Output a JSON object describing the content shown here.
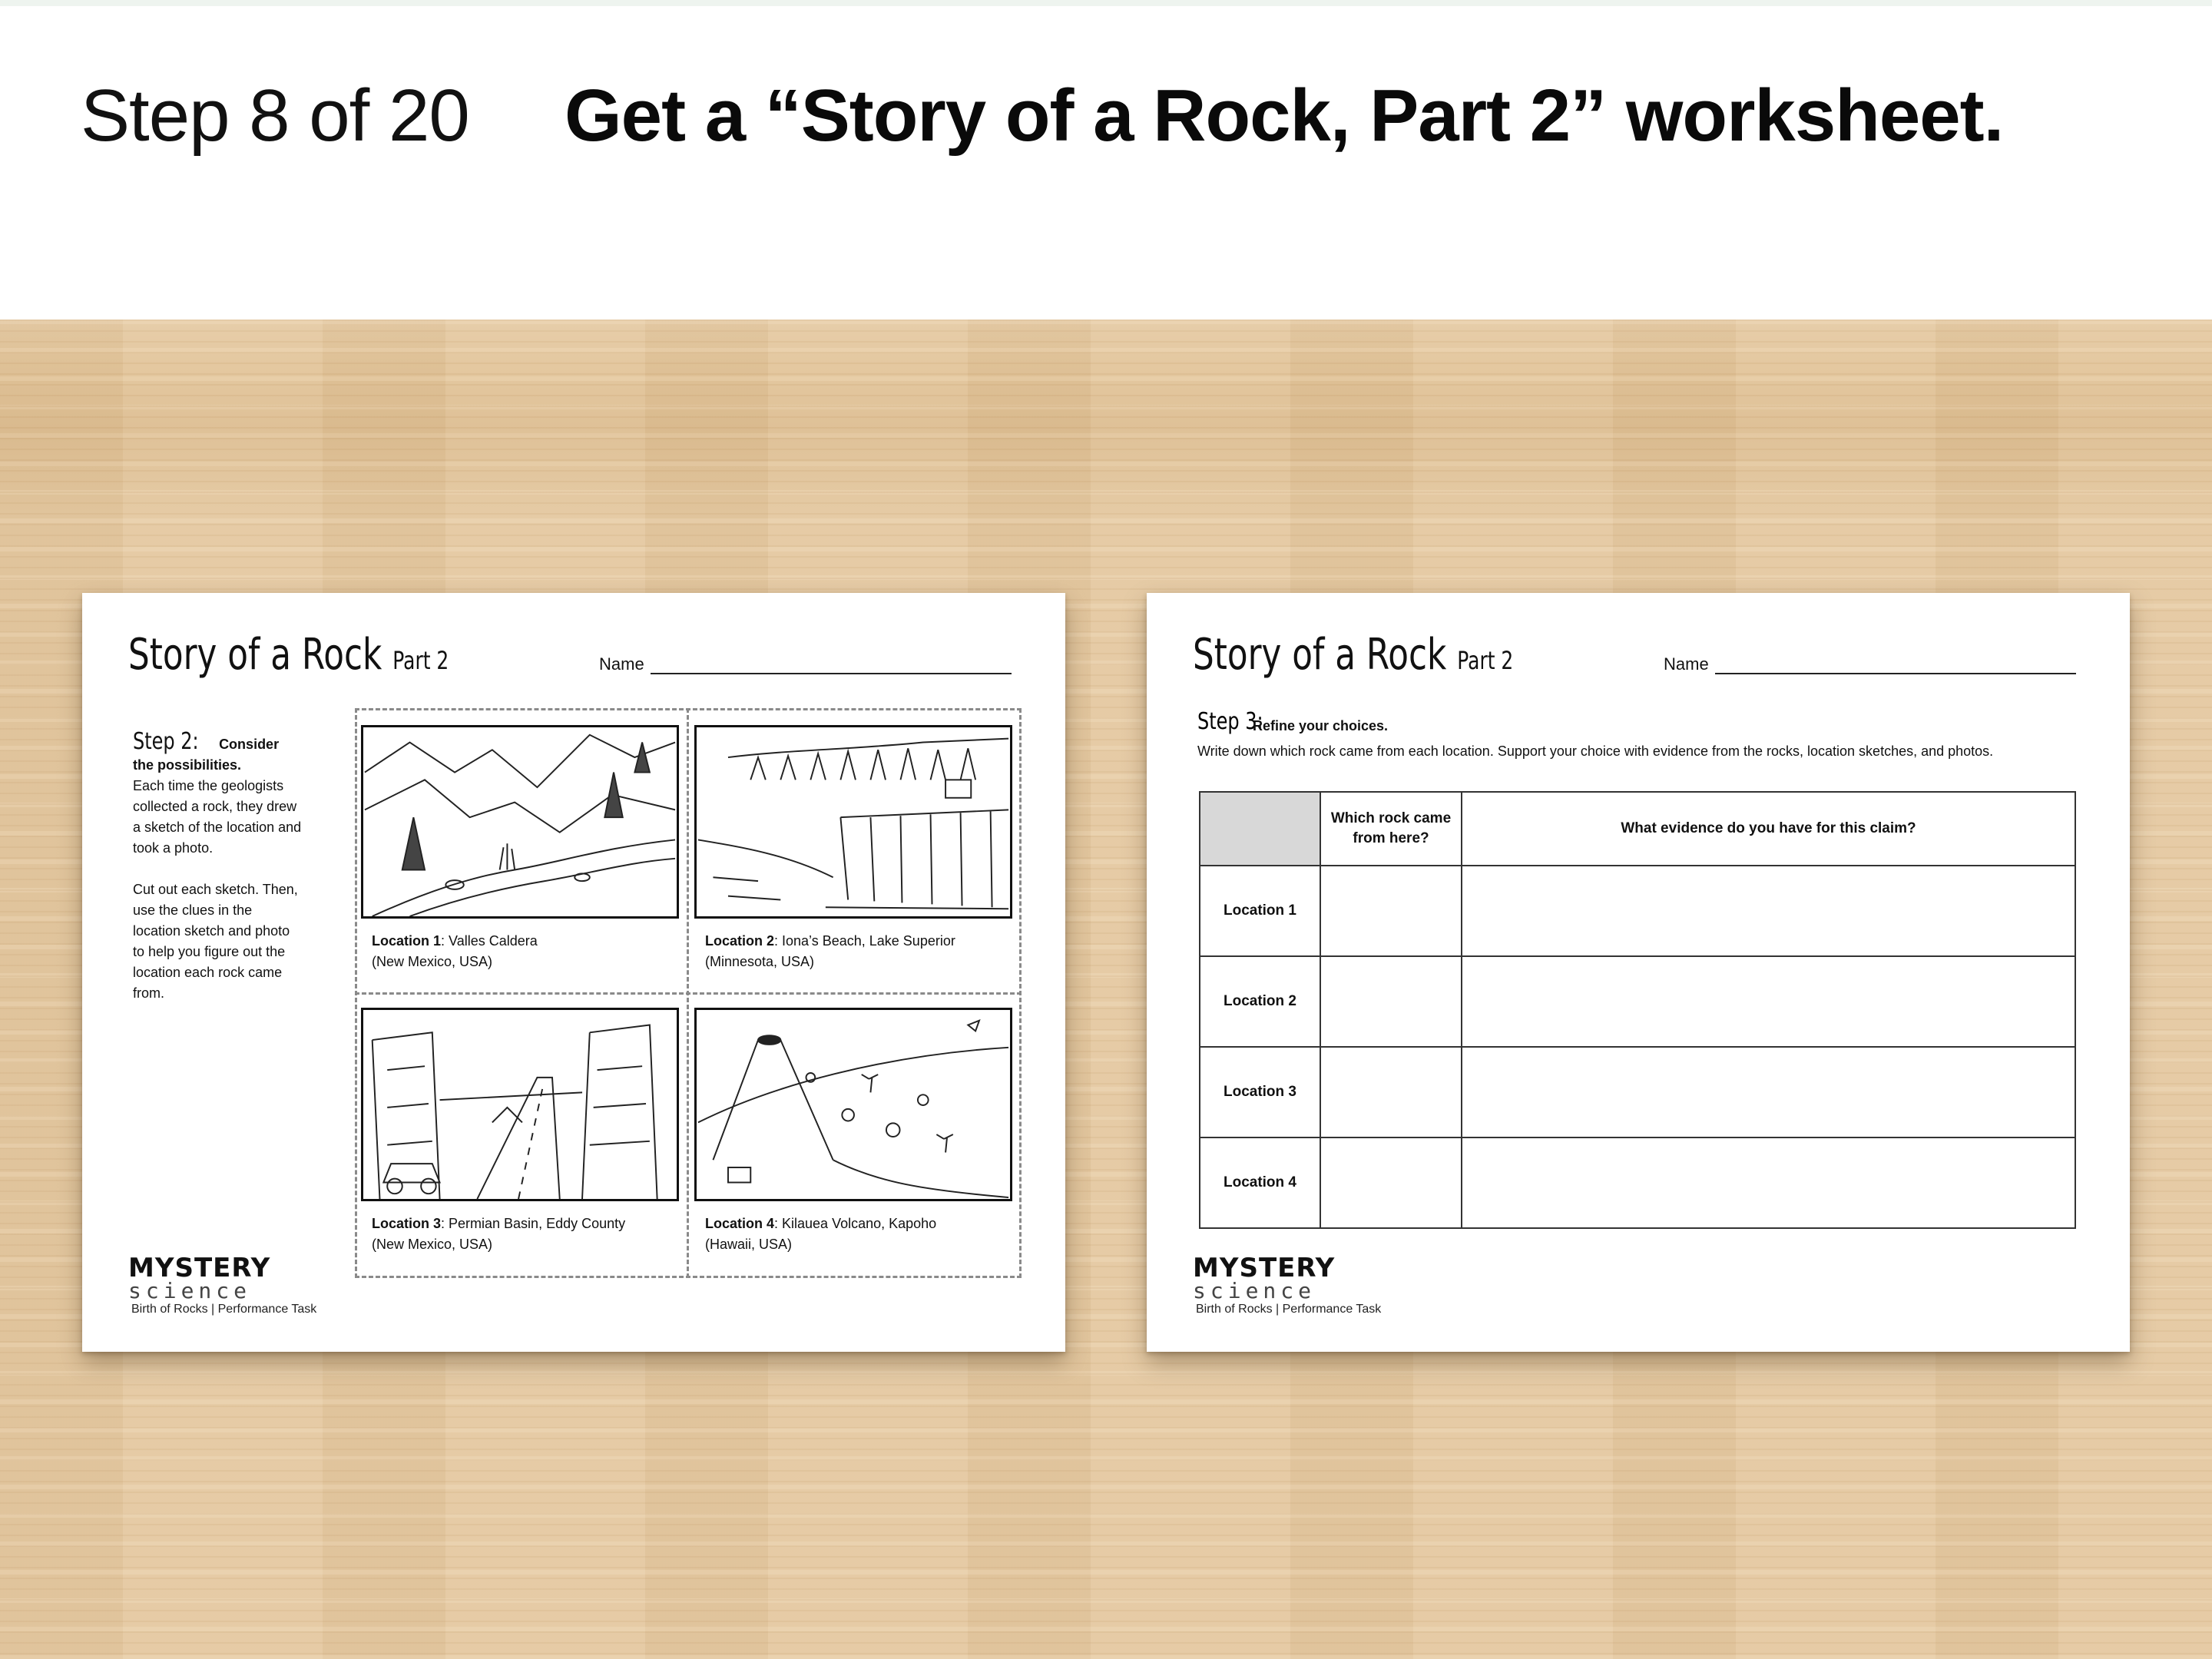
{
  "header": {
    "step_counter": "Step 8 of 20",
    "title": "Get a “Story of a Rock, Part 2” worksheet."
  },
  "colors": {
    "desk": "#e3c69c",
    "header_bg": "#ffffff",
    "table_header_fill": "#d8d8d8"
  },
  "worksheet_left": {
    "title": "Story of a Rock",
    "title_part": "Part 2",
    "name_label": "Name",
    "instructions": {
      "heading": "Step 2:",
      "subheading": "Consider the possibilities.",
      "paragraph1": "Each time the geologists collected a rock, they drew a sketch of the location and took a photo.",
      "paragraph2": "Cut out each sketch. Then, use the clues in the location sketch and photo to help you figure out the location each rock came from."
    },
    "locations": [
      {
        "label": "Location 1",
        "name": ": Valles Caldera",
        "region": "(New Mexico, USA)"
      },
      {
        "label": "Location 2",
        "name": ": Iona’s Beach, Lake Superior",
        "region": "(Minnesota, USA)"
      },
      {
        "label": "Location 3",
        "name": ": Permian Basin, Eddy County",
        "region": "(New Mexico, USA)"
      },
      {
        "label": "Location 4",
        "name": ": Kilauea Volcano, Kapoho",
        "region": "(Hawaii, USA)"
      }
    ],
    "logo_top": "MYSTERY",
    "logo_bottom": "science",
    "footer": "Birth of Rocks | Performance Task"
  },
  "worksheet_right": {
    "title": "Story of a Rock",
    "title_part": "Part 2",
    "name_label": "Name",
    "step_heading": "Step 3:",
    "step_sub": "Refine your choices.",
    "description": "Write down which rock came from each location. Support your choice with evidence from the rocks, location sketches, and photos.",
    "table": {
      "col1": "Which rock came from here?",
      "col2": "What evidence do you have for this claim?",
      "rows": [
        "Location 1",
        "Location 2",
        "Location 3",
        "Location 4"
      ]
    },
    "logo_top": "MYSTERY",
    "logo_bottom": "science",
    "footer": "Birth of Rocks | Performance Task"
  }
}
